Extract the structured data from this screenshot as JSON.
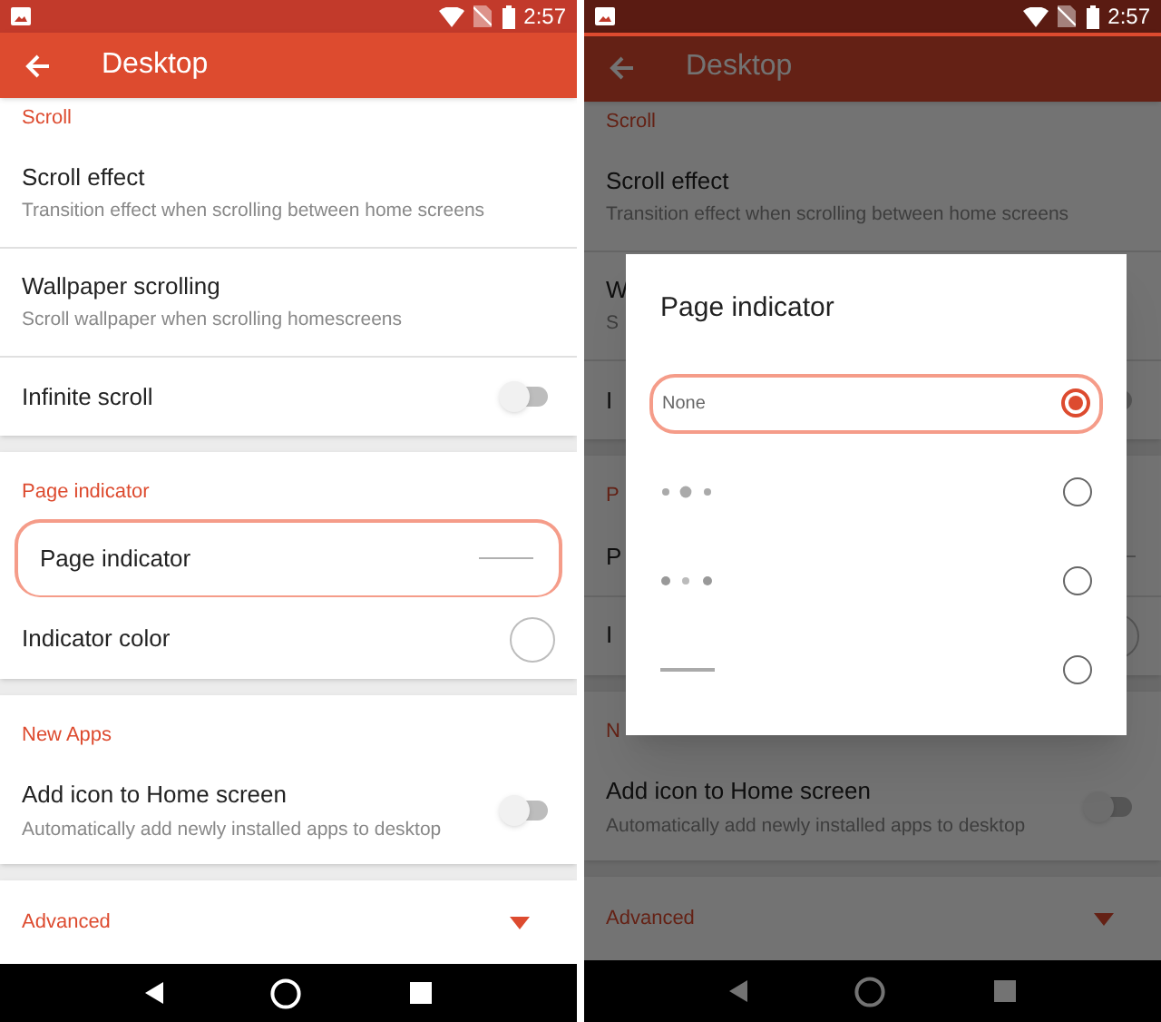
{
  "left_screen": {
    "status_bar": {
      "time": "2:57"
    },
    "app_bar": {
      "title": "Desktop"
    },
    "sections": [
      {
        "header": "Scroll",
        "items": [
          {
            "kind": "text",
            "title": "Scroll effect",
            "subtitle": "Transition effect when scrolling between home screens"
          },
          {
            "kind": "text",
            "title": "Wallpaper scrolling",
            "subtitle": "Scroll wallpaper when scrolling homescreens"
          },
          {
            "kind": "toggle",
            "title": "Infinite scroll",
            "on": false
          }
        ]
      },
      {
        "header": "Page indicator",
        "items": [
          {
            "kind": "line",
            "title": "Page indicator",
            "highlighted": true
          },
          {
            "kind": "color",
            "title": "Indicator color",
            "color": "#ffffff"
          }
        ]
      },
      {
        "header": "New Apps",
        "items": [
          {
            "kind": "toggle",
            "title": "Add icon to Home screen",
            "subtitle": "Automatically add newly installed apps to desktop",
            "on": false
          }
        ]
      },
      {
        "kind": "expander",
        "label": "Advanced",
        "expanded": false
      }
    ]
  },
  "right_screen": {
    "status_bar": {
      "time": "2:57"
    },
    "app_bar": {
      "title": "Desktop"
    },
    "sections": [
      {
        "header": "Scroll",
        "items": [
          {
            "kind": "text",
            "title": "Scroll effect",
            "subtitle": "Transition effect when scrolling between home screens"
          },
          {
            "kind": "text",
            "title": "W",
            "subtitle": "S"
          },
          {
            "kind": "toggle",
            "title": "I",
            "on": false
          }
        ]
      },
      {
        "header": "P",
        "items": [
          {
            "kind": "line",
            "title": "P"
          },
          {
            "kind": "color",
            "title": "I",
            "color": "#ffffff"
          }
        ]
      },
      {
        "header": "N",
        "items": [
          {
            "kind": "toggle",
            "title": "Add icon to Home screen",
            "subtitle": "Automatically add newly installed apps to desktop",
            "on": false
          }
        ]
      },
      {
        "kind": "expander",
        "label": "Advanced",
        "expanded": false
      }
    ],
    "dialog": {
      "title": "Page indicator",
      "options": [
        {
          "kind": "text",
          "label": "None",
          "selected": true,
          "highlighted": true
        },
        {
          "kind": "dots-large-middle",
          "selected": false
        },
        {
          "kind": "dots-small-middle",
          "selected": false
        },
        {
          "kind": "line",
          "selected": false
        }
      ]
    }
  }
}
